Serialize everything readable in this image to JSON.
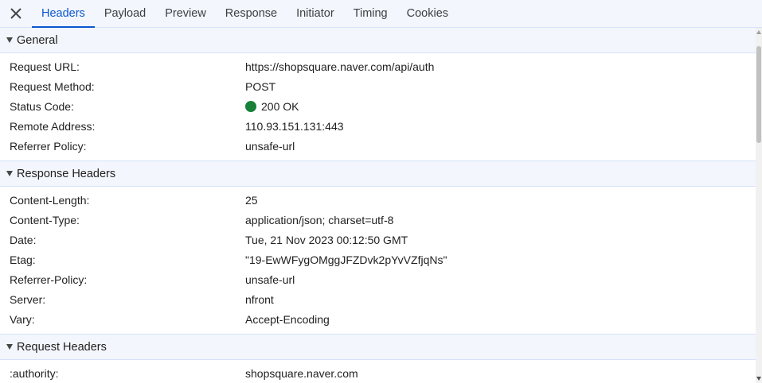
{
  "tabs": [
    {
      "label": "Headers",
      "active": true
    },
    {
      "label": "Payload",
      "active": false
    },
    {
      "label": "Preview",
      "active": false
    },
    {
      "label": "Response",
      "active": false
    },
    {
      "label": "Initiator",
      "active": false
    },
    {
      "label": "Timing",
      "active": false
    },
    {
      "label": "Cookies",
      "active": false
    }
  ],
  "general": {
    "title": "General",
    "rows": [
      {
        "key": "Request URL:",
        "value": "https://shopsquare.naver.com/api/auth"
      },
      {
        "key": "Request Method:",
        "value": "POST"
      },
      {
        "key": "Status Code:",
        "value": "200 OK"
      },
      {
        "key": "Remote Address:",
        "value": "110.93.151.131:443"
      },
      {
        "key": "Referrer Policy:",
        "value": "unsafe-url"
      }
    ]
  },
  "response_headers": {
    "title": "Response Headers",
    "rows": [
      {
        "key": "Content-Length:",
        "value": "25"
      },
      {
        "key": "Content-Type:",
        "value": "application/json; charset=utf-8"
      },
      {
        "key": "Date:",
        "value": "Tue, 21 Nov 2023 00:12:50 GMT"
      },
      {
        "key": "Etag:",
        "value": "\"19-EwWFygOMggJFZDvk2pYvVZfjqNs\""
      },
      {
        "key": "Referrer-Policy:",
        "value": "unsafe-url"
      },
      {
        "key": "Server:",
        "value": "nfront"
      },
      {
        "key": "Vary:",
        "value": "Accept-Encoding"
      }
    ]
  },
  "request_headers": {
    "title": "Request Headers",
    "rows": [
      {
        "key": ":authority:",
        "value": "shopsquare.naver.com"
      }
    ]
  },
  "colors": {
    "accent": "#0b57d0",
    "status_ok": "#188038",
    "header_bg": "#f3f6fc"
  }
}
